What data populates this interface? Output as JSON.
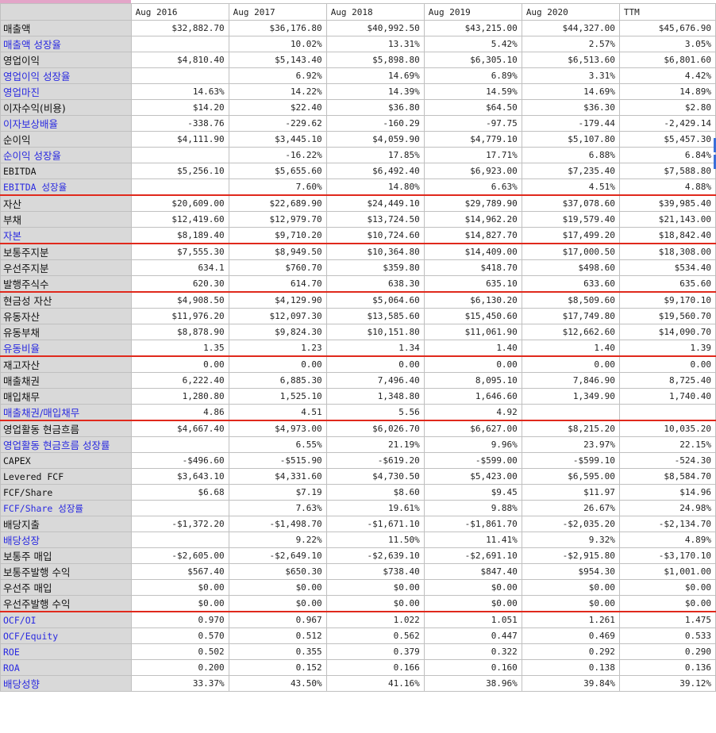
{
  "columns": [
    "Aug 2016",
    "Aug 2017",
    "Aug 2018",
    "Aug 2019",
    "Aug 2020",
    "TTM"
  ],
  "rows": [
    {
      "label": "매출액",
      "highlight": false,
      "mono": false,
      "values": [
        "$32,882.70",
        "$36,176.80",
        "$40,992.50",
        "$43,215.00",
        "$44,327.00",
        "$45,676.90"
      ]
    },
    {
      "label": "매출액 성장율",
      "highlight": true,
      "mono": false,
      "values": [
        "",
        "10.02%",
        "13.31%",
        "5.42%",
        "2.57%",
        "3.05%"
      ]
    },
    {
      "label": "영업이익",
      "highlight": false,
      "mono": false,
      "values": [
        "$4,810.40",
        "$5,143.40",
        "$5,898.80",
        "$6,305.10",
        "$6,513.60",
        "$6,801.60"
      ]
    },
    {
      "label": "영업이익 성장율",
      "highlight": true,
      "mono": false,
      "values": [
        "",
        "6.92%",
        "14.69%",
        "6.89%",
        "3.31%",
        "4.42%"
      ]
    },
    {
      "label": "영업마진",
      "highlight": true,
      "mono": false,
      "values": [
        "14.63%",
        "14.22%",
        "14.39%",
        "14.59%",
        "14.69%",
        "14.89%"
      ]
    },
    {
      "label": "이자수익(비용)",
      "highlight": false,
      "mono": false,
      "values": [
        "$14.20",
        "$22.40",
        "$36.80",
        "$64.50",
        "$36.30",
        "$2.80"
      ]
    },
    {
      "label": "이자보상배율",
      "highlight": true,
      "mono": false,
      "values": [
        "-338.76",
        "-229.62",
        "-160.29",
        "-97.75",
        "-179.44",
        "-2,429.14"
      ]
    },
    {
      "label": "순이익",
      "highlight": false,
      "mono": false,
      "values": [
        "$4,111.90",
        "$3,445.10",
        "$4,059.90",
        "$4,779.10",
        "$5,107.80",
        "$5,457.30"
      ]
    },
    {
      "label": "순이익 성장율",
      "highlight": true,
      "mono": false,
      "values": [
        "",
        "-16.22%",
        "17.85%",
        "17.71%",
        "6.88%",
        "6.84%"
      ]
    },
    {
      "label": "EBITDA",
      "highlight": false,
      "mono": true,
      "values": [
        "$5,256.10",
        "$5,655.60",
        "$6,492.40",
        "$6,923.00",
        "$7,235.40",
        "$7,588.80"
      ]
    },
    {
      "label": "EBITDA 성장율",
      "highlight": true,
      "mono": true,
      "values": [
        "",
        "7.60%",
        "14.80%",
        "6.63%",
        "4.51%",
        "4.88%"
      ]
    },
    {
      "label": "자산",
      "highlight": false,
      "mono": false,
      "values": [
        "$20,609.00",
        "$22,689.90",
        "$24,449.10",
        "$29,789.90",
        "$37,078.60",
        "$39,985.40"
      ]
    },
    {
      "label": "부채",
      "highlight": false,
      "mono": false,
      "values": [
        "$12,419.60",
        "$12,979.70",
        "$13,724.50",
        "$14,962.20",
        "$19,579.40",
        "$21,143.00"
      ]
    },
    {
      "label": "자본",
      "highlight": true,
      "mono": false,
      "values": [
        "$8,189.40",
        "$9,710.20",
        "$10,724.60",
        "$14,827.70",
        "$17,499.20",
        "$18,842.40"
      ]
    },
    {
      "label": "보통주지분",
      "highlight": false,
      "mono": false,
      "values": [
        "$7,555.30",
        "$8,949.50",
        "$10,364.80",
        "$14,409.00",
        "$17,000.50",
        "$18,308.00"
      ]
    },
    {
      "label": "우선주지분",
      "highlight": false,
      "mono": false,
      "values": [
        "634.1",
        "$760.70",
        "$359.80",
        "$418.70",
        "$498.60",
        "$534.40"
      ]
    },
    {
      "label": "발행주식수",
      "highlight": false,
      "mono": false,
      "values": [
        "620.30",
        "614.70",
        "638.30",
        "635.10",
        "633.60",
        "635.60"
      ]
    },
    {
      "label": "현금성 자산",
      "highlight": false,
      "mono": false,
      "values": [
        "$4,908.50",
        "$4,129.90",
        "$5,064.60",
        "$6,130.20",
        "$8,509.60",
        "$9,170.10"
      ]
    },
    {
      "label": "유동자산",
      "highlight": false,
      "mono": false,
      "values": [
        "$11,976.20",
        "$12,097.30",
        "$13,585.60",
        "$15,450.60",
        "$17,749.80",
        "$19,560.70"
      ]
    },
    {
      "label": "유동부채",
      "highlight": false,
      "mono": false,
      "values": [
        "$8,878.90",
        "$9,824.30",
        "$10,151.80",
        "$11,061.90",
        "$12,662.60",
        "$14,090.70"
      ]
    },
    {
      "label": "유동비율",
      "highlight": true,
      "mono": false,
      "values": [
        "1.35",
        "1.23",
        "1.34",
        "1.40",
        "1.40",
        "1.39"
      ]
    },
    {
      "label": "재고자산",
      "highlight": false,
      "mono": false,
      "values": [
        "0.00",
        "0.00",
        "0.00",
        "0.00",
        "0.00",
        "0.00"
      ]
    },
    {
      "label": "매출채권",
      "highlight": false,
      "mono": false,
      "values": [
        "6,222.40",
        "6,885.30",
        "7,496.40",
        "8,095.10",
        "7,846.90",
        "8,725.40"
      ]
    },
    {
      "label": "매입채무",
      "highlight": false,
      "mono": false,
      "values": [
        "1,280.80",
        "1,525.10",
        "1,348.80",
        "1,646.60",
        "1,349.90",
        "1,740.40"
      ]
    },
    {
      "label": "매출채권/매입채무",
      "highlight": true,
      "mono": false,
      "values": [
        "4.86",
        "4.51",
        "5.56",
        "4.92",
        "",
        ""
      ]
    },
    {
      "label": "영업활동 현금흐름",
      "highlight": false,
      "mono": false,
      "values": [
        "$4,667.40",
        "$4,973.00",
        "$6,026.70",
        "$6,627.00",
        "$8,215.20",
        "10,035.20"
      ]
    },
    {
      "label": "영업활동 현금흐름 성장률",
      "highlight": true,
      "mono": false,
      "values": [
        "",
        "6.55%",
        "21.19%",
        "9.96%",
        "23.97%",
        "22.15%"
      ]
    },
    {
      "label": "CAPEX",
      "highlight": false,
      "mono": true,
      "values": [
        "-$496.60",
        "-$515.90",
        "-$619.20",
        "-$599.00",
        "-$599.10",
        "-524.30"
      ]
    },
    {
      "label": "Levered FCF",
      "highlight": false,
      "mono": true,
      "values": [
        "$3,643.10",
        "$4,331.60",
        "$4,730.50",
        "$5,423.00",
        "$6,595.00",
        "$8,584.70"
      ]
    },
    {
      "label": "FCF/Share",
      "highlight": false,
      "mono": true,
      "values": [
        "$6.68",
        "$7.19",
        "$8.60",
        "$9.45",
        "$11.97",
        "$14.96"
      ]
    },
    {
      "label": "FCF/Share 성장률",
      "highlight": true,
      "mono": true,
      "values": [
        "",
        "7.63%",
        "19.61%",
        "9.88%",
        "26.67%",
        "24.98%"
      ]
    },
    {
      "label": "배당지출",
      "highlight": false,
      "mono": false,
      "values": [
        "-$1,372.20",
        "-$1,498.70",
        "-$1,671.10",
        "-$1,861.70",
        "-$2,035.20",
        "-$2,134.70"
      ]
    },
    {
      "label": "배당성장",
      "highlight": true,
      "mono": false,
      "values": [
        "",
        "9.22%",
        "11.50%",
        "11.41%",
        "9.32%",
        "4.89%"
      ]
    },
    {
      "label": "보통주 매입",
      "highlight": false,
      "mono": false,
      "values": [
        "-$2,605.00",
        "-$2,649.10",
        "-$2,639.10",
        "-$2,691.10",
        "-$2,915.80",
        "-$3,170.10"
      ]
    },
    {
      "label": "보통주발행 수익",
      "highlight": false,
      "mono": false,
      "values": [
        "$567.40",
        "$650.30",
        "$738.40",
        "$847.40",
        "$954.30",
        "$1,001.00"
      ]
    },
    {
      "label": "우선주 매입",
      "highlight": false,
      "mono": false,
      "values": [
        "$0.00",
        "$0.00",
        "$0.00",
        "$0.00",
        "$0.00",
        "$0.00"
      ]
    },
    {
      "label": "우선주발행 수익",
      "highlight": false,
      "mono": false,
      "values": [
        "$0.00",
        "$0.00",
        "$0.00",
        "$0.00",
        "$0.00",
        "$0.00"
      ]
    },
    {
      "label": "OCF/OI",
      "highlight": true,
      "mono": true,
      "values": [
        "0.970",
        "0.967",
        "1.022",
        "1.051",
        "1.261",
        "1.475"
      ]
    },
    {
      "label": "OCF/Equity",
      "highlight": true,
      "mono": true,
      "values": [
        "0.570",
        "0.512",
        "0.562",
        "0.447",
        "0.469",
        "0.533"
      ]
    },
    {
      "label": "ROE",
      "highlight": true,
      "mono": true,
      "values": [
        "0.502",
        "0.355",
        "0.379",
        "0.322",
        "0.292",
        "0.290"
      ]
    },
    {
      "label": "ROA",
      "highlight": true,
      "mono": true,
      "values": [
        "0.200",
        "0.152",
        "0.166",
        "0.160",
        "0.138",
        "0.136"
      ]
    },
    {
      "label": "배당성향",
      "highlight": true,
      "mono": false,
      "values": [
        "33.37%",
        "43.50%",
        "41.16%",
        "38.96%",
        "39.84%",
        "39.12%"
      ]
    }
  ],
  "group_end_rows": [
    10,
    13,
    16,
    20,
    24,
    36
  ],
  "colors": {
    "label_bg": "#d9d9d9",
    "highlight_text": "#2a2ae0",
    "separator": "#e0291c",
    "selection": "#3a6fd8",
    "corner_mark": "#e3a5c8"
  }
}
